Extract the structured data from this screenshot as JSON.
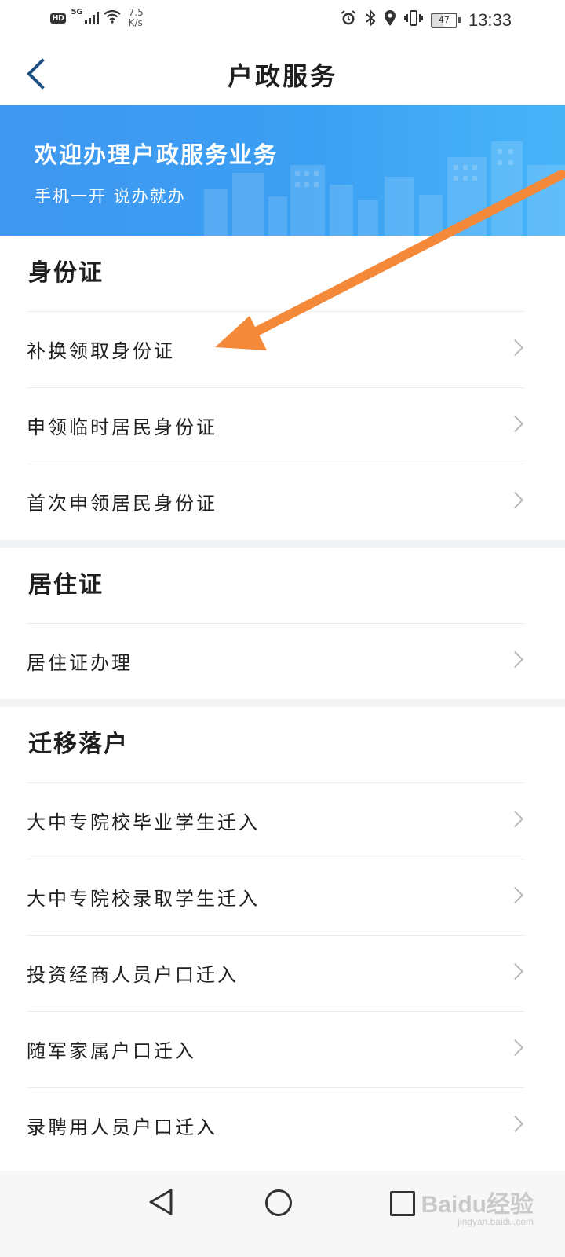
{
  "status_bar": {
    "hd": "HD",
    "network": "5G",
    "speed_value": "7.5",
    "speed_unit": "K/s",
    "battery": "47",
    "time": "13:33"
  },
  "header": {
    "title": "户政服务"
  },
  "banner": {
    "title": "欢迎办理户政服务业务",
    "subtitle": "手机一开 说办就办"
  },
  "sections": [
    {
      "title": "身份证",
      "items": [
        {
          "label": "补换领取身份证"
        },
        {
          "label": "申领临时居民身份证"
        },
        {
          "label": "首次申领居民身份证"
        }
      ]
    },
    {
      "title": "居住证",
      "items": [
        {
          "label": "居住证办理"
        }
      ]
    },
    {
      "title": "迁移落户",
      "items": [
        {
          "label": "大中专院校毕业学生迁入"
        },
        {
          "label": "大中专院校录取学生迁入"
        },
        {
          "label": "投资经商人员户口迁入"
        },
        {
          "label": "随军家属户口迁入"
        },
        {
          "label": "录聘用人员户口迁入"
        }
      ]
    }
  ],
  "watermark": {
    "brand": "Baidu经验",
    "url": "jingyan.baidu.com"
  },
  "colors": {
    "banner_start": "#3f97f0",
    "banner_end": "#48b4f8",
    "back_arrow": "#1d4e82",
    "annotation_arrow": "#f5893a"
  }
}
